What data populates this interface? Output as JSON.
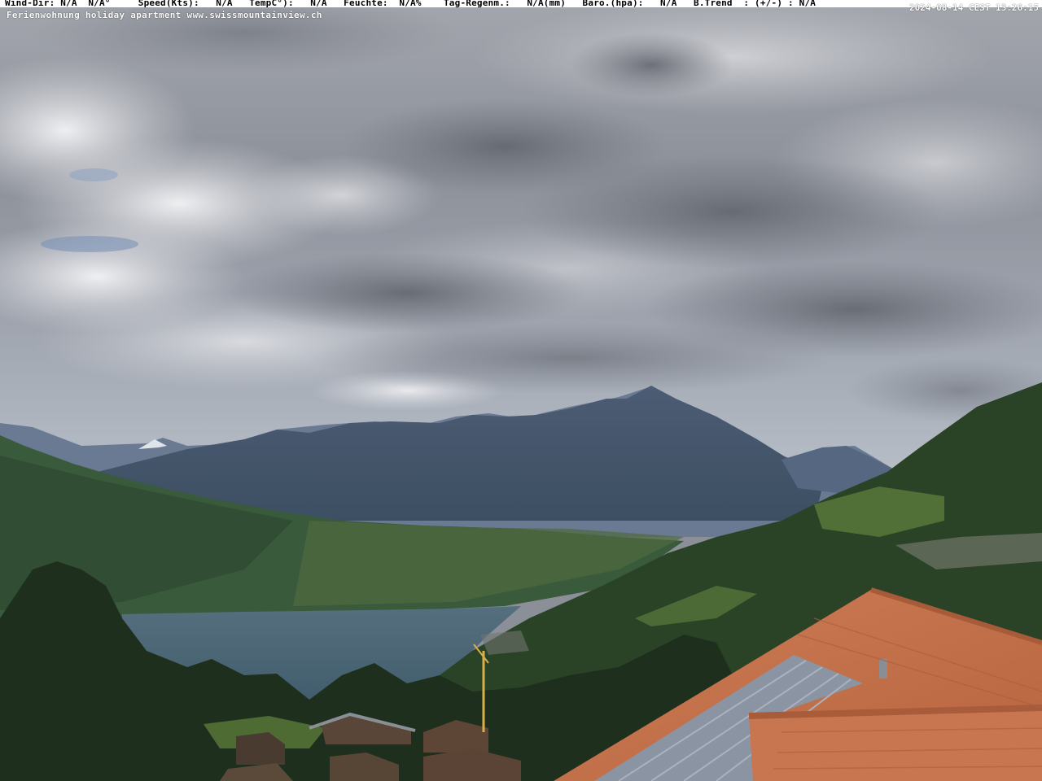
{
  "overlay": {
    "weather_line": "Wind-Dir: N/A  N/A°     Speed(Kts):   N/A   TempC°):   N/A   Feuchte:  N/A%    Tag-Regenm.:   N/A(mm)   Baro.(hpa):   N/A   B.Trend  : (+/-) : N/A",
    "timestamp": "2024-08-14 CEST 13:26:15",
    "caption": "Ferienwohnung holiday apartment www.swissmountainview.ch"
  },
  "colors": {
    "sky_top": "#9a9ea6",
    "sky_mid": "#c9c9cf",
    "cloud_dark": "#6f737c",
    "mountain_far": "#5d6d85",
    "mountain_mid": "#3f4f63",
    "hill_green": "#2f4a30",
    "lake": "#4a6676",
    "roof": "#c9764f",
    "solar": "#8e97a5",
    "trees": "#1f2f1e"
  }
}
